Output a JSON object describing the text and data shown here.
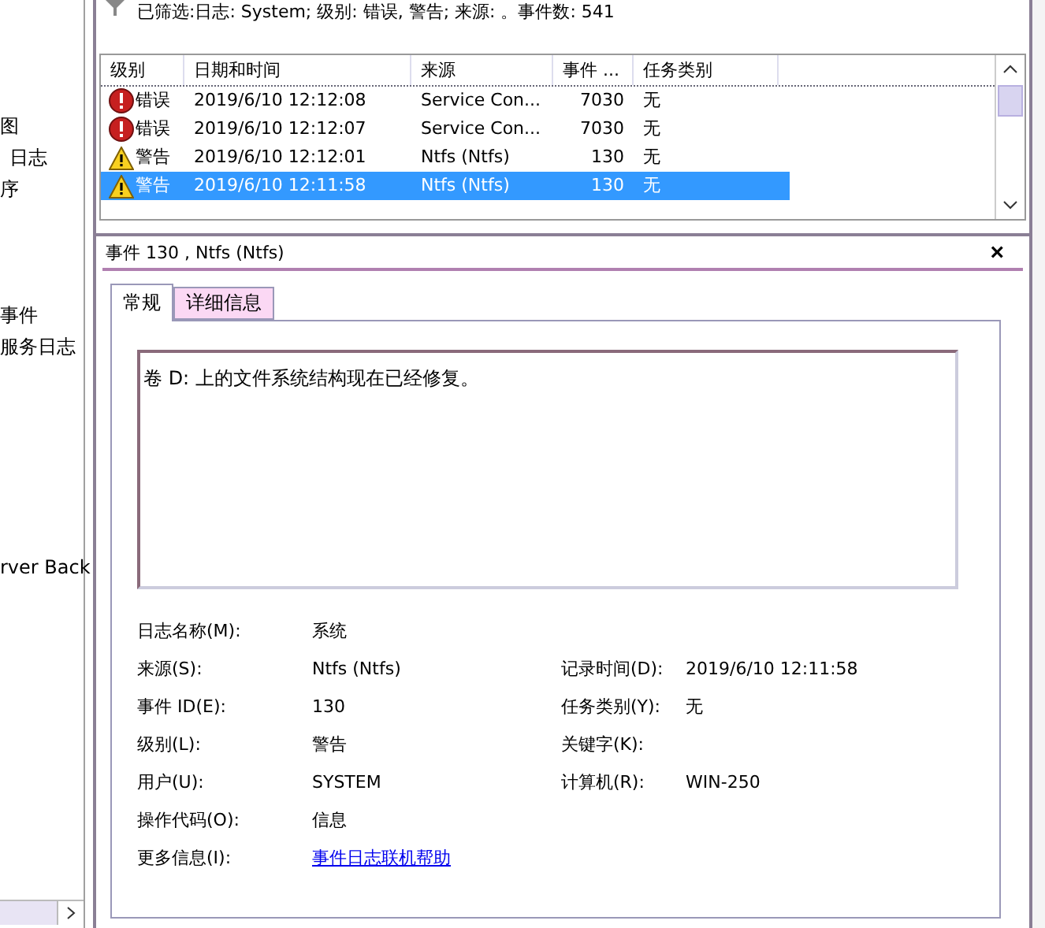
{
  "sidebar": {
    "items": [
      {
        "label": "图"
      },
      {
        "label": "日志"
      },
      {
        "label": "序"
      },
      {
        "label": "事件"
      },
      {
        "label": "服务日志"
      },
      {
        "label": "rver Back"
      }
    ]
  },
  "filter": {
    "text": "已筛选:日志: System; 级别: 错误, 警告; 来源: 。事件数: 541"
  },
  "table": {
    "columns": [
      "级别",
      "日期和时间",
      "来源",
      "事件 ...",
      "任务类别"
    ],
    "rows": [
      {
        "kind": "error",
        "level": "错误",
        "datetime": "2019/6/10 12:12:08",
        "source": "Service Con...",
        "event_id": "7030",
        "task": "无",
        "selected": false
      },
      {
        "kind": "error",
        "level": "错误",
        "datetime": "2019/6/10 12:12:07",
        "source": "Service Con...",
        "event_id": "7030",
        "task": "无",
        "selected": false
      },
      {
        "kind": "warning",
        "level": "警告",
        "datetime": "2019/6/10 12:12:01",
        "source": "Ntfs (Ntfs)",
        "event_id": "130",
        "task": "无",
        "selected": false
      },
      {
        "kind": "warning",
        "level": "警告",
        "datetime": "2019/6/10 12:11:58",
        "source": "Ntfs (Ntfs)",
        "event_id": "130",
        "task": "无",
        "selected": true
      }
    ]
  },
  "detail": {
    "title": "事件 130 , Ntfs (Ntfs)",
    "close": "×",
    "tabs": [
      {
        "label": "常规",
        "selected": true
      },
      {
        "label": "详细信息",
        "selected": false
      }
    ],
    "message": "卷 D: 上的文件系统结构现在已经修复。",
    "fields": [
      {
        "label": "日志名称(M):",
        "value": "系统"
      },
      {
        "label": "来源(S):",
        "value": "Ntfs (Ntfs)",
        "label2": "记录时间(D):",
        "value2": "2019/6/10 12:11:58"
      },
      {
        "label": "事件 ID(E):",
        "value": "130",
        "label2": "任务类别(Y):",
        "value2": "无"
      },
      {
        "label": "级别(L):",
        "value": "警告",
        "label2": "关键字(K):"
      },
      {
        "label": "用户(U):",
        "value": "SYSTEM",
        "label2": "计算机(R):",
        "value2": "WIN-250"
      },
      {
        "label": "操作代码(O):",
        "value": "信息"
      }
    ],
    "more_info": {
      "label": "更多信息(I):",
      "link": "事件日志联机帮助"
    }
  }
}
